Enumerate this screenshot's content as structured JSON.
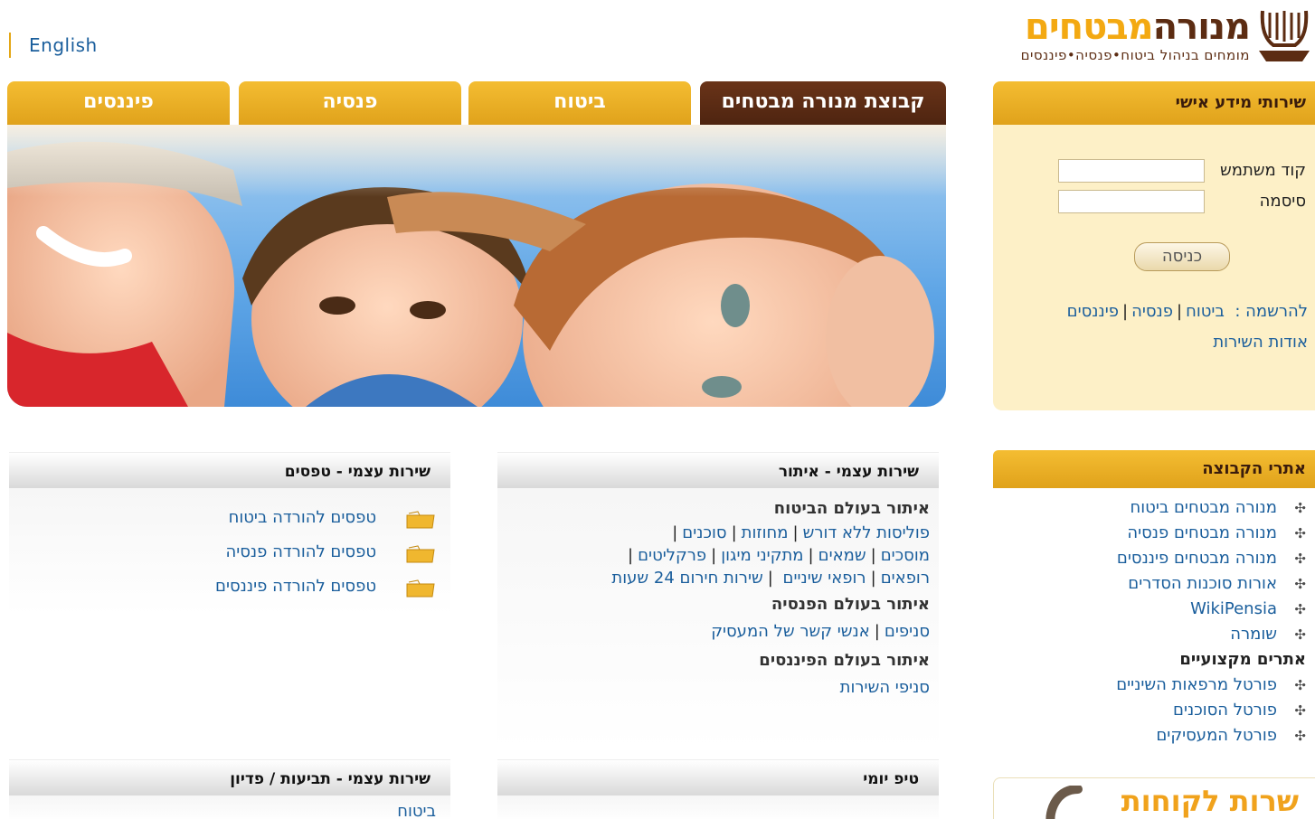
{
  "header": {
    "language_link": "English",
    "logo": {
      "name_part1": "מנורה",
      "name_part2": "מבטחים",
      "tagline": "מומחים בניהול ביטוח•פנסיה•פיננסים"
    }
  },
  "tabs": [
    {
      "label": "קבוצת מנורה מבטחים",
      "active": true
    },
    {
      "label": "ביטוח",
      "active": false
    },
    {
      "label": "פנסיה",
      "active": false
    },
    {
      "label": "פיננסים",
      "active": false
    }
  ],
  "login": {
    "title": "שירותי מידע אישי",
    "username_label": "קוד משתמש",
    "password_label": "סיסמה",
    "submit_label": "כניסה",
    "register_label": "להרשמה :",
    "register_links": [
      "ביטוח",
      "פנסיה",
      "פיננסים"
    ],
    "about_link": "אודות השירות"
  },
  "group_sites": {
    "title": "אתרי הקבוצה",
    "items": [
      "מנורה מבטחים ביטוח",
      "מנורה מבטחים פנסיה",
      "מנורה מבטחים פיננסים",
      "אורות סוכנות הסדרים",
      "WikiPensia",
      "שומרה"
    ],
    "professional_title": "אתרים מקצועיים",
    "professional_items": [
      "פורטל מרפאות השיניים",
      "פורטל הסוכנים",
      "פורטל המעסיקים"
    ]
  },
  "customer_service": {
    "label": "שרות לקוחות"
  },
  "self_service_search": {
    "title": "שירות עצמי - איתור",
    "insurance_title": "איתור בעולם הביטוח",
    "insurance_row1": [
      "פוליסות ללא דורש",
      "מחוזות",
      "סוכנים"
    ],
    "insurance_row2": [
      "מוסכים",
      "שמאים",
      "מתקיני מיגון",
      "פרקליטים"
    ],
    "insurance_row3": [
      "רופאים",
      "רופאי שיניים",
      "שירות חירום 24 שעות"
    ],
    "pension_title": "איתור בעולם הפנסיה",
    "pension_row": [
      "סניפים",
      "אנשי קשר של המעסיק"
    ],
    "finance_title": "איתור בעולם הפיננסים",
    "finance_row": [
      "סניפי השירות"
    ]
  },
  "self_service_forms": {
    "title": "שירות עצמי - טפסים",
    "items": [
      "טפסים להורדה ביטוח",
      "טפסים להורדה פנסיה",
      "טפסים להורדה פיננסים"
    ]
  },
  "daily_tip": {
    "title": "טיפ יומי"
  },
  "claims": {
    "title": "שירות עצמי - תביעות / פדיון",
    "first_item": "ביטוח"
  },
  "colors": {
    "accent": "#e8ac1f",
    "brand_brown": "#5c2c12",
    "link": "#1a5e9c",
    "login_bg": "#fdf0c7"
  }
}
